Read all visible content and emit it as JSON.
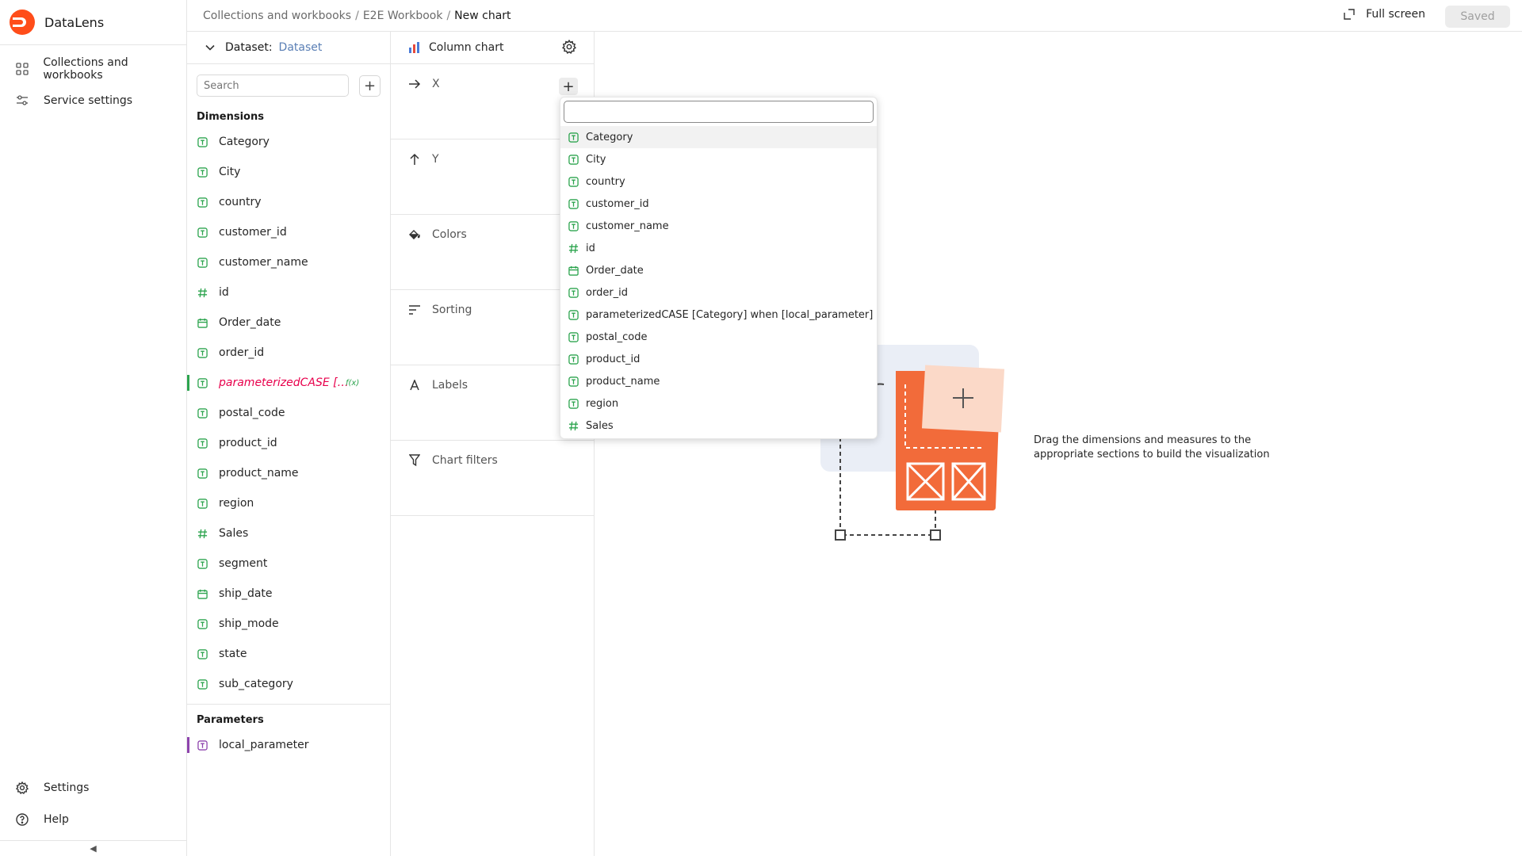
{
  "app": {
    "name": "DataLens"
  },
  "nav": {
    "items": [
      {
        "label": "Collections and workbooks",
        "icon": "grid-icon"
      },
      {
        "label": "Service settings",
        "icon": "sliders-icon"
      }
    ],
    "bottom": [
      {
        "label": "Settings",
        "icon": "gear-icon"
      },
      {
        "label": "Help",
        "icon": "help-icon"
      }
    ],
    "collapse": "◀"
  },
  "breadcrumbs": [
    {
      "label": "Collections and workbooks"
    },
    {
      "label": "E2E Workbook"
    },
    {
      "label": "New chart"
    }
  ],
  "header": {
    "fullscreen_label": "Full screen",
    "saved_label": "Saved"
  },
  "dataset": {
    "label": "Dataset:",
    "name": "Dataset",
    "search_placeholder": "Search",
    "dimensions_title": "Dimensions",
    "fields": [
      {
        "name": "Category",
        "type": "text"
      },
      {
        "name": "City",
        "type": "text"
      },
      {
        "name": "country",
        "type": "text"
      },
      {
        "name": "customer_id",
        "type": "text"
      },
      {
        "name": "customer_name",
        "type": "text"
      },
      {
        "name": "id",
        "type": "number"
      },
      {
        "name": "Order_date",
        "type": "date"
      },
      {
        "name": "order_id",
        "type": "text"
      },
      {
        "name": "parameterizedCASE […",
        "type": "text",
        "active": true,
        "fx": "f(x)"
      },
      {
        "name": "postal_code",
        "type": "text"
      },
      {
        "name": "product_id",
        "type": "text"
      },
      {
        "name": "product_name",
        "type": "text"
      },
      {
        "name": "region",
        "type": "text"
      },
      {
        "name": "Sales",
        "type": "number"
      },
      {
        "name": "segment",
        "type": "text"
      },
      {
        "name": "ship_date",
        "type": "date"
      },
      {
        "name": "ship_mode",
        "type": "text"
      },
      {
        "name": "state",
        "type": "text"
      },
      {
        "name": "sub_category",
        "type": "text"
      }
    ],
    "parameters_title": "Parameters",
    "parameters": [
      {
        "name": "local_parameter",
        "type": "text"
      }
    ]
  },
  "placeholders": {
    "chart_type": "Column chart",
    "sections": [
      {
        "label": "X",
        "icon": "arrow-right-icon"
      },
      {
        "label": "Y",
        "icon": "arrow-up-icon"
      },
      {
        "label": "Colors",
        "icon": "paint-bucket-icon"
      },
      {
        "label": "Sorting",
        "icon": "sort-icon"
      },
      {
        "label": "Labels",
        "icon": "label-a-icon"
      },
      {
        "label": "Chart filters",
        "icon": "filter-icon"
      }
    ]
  },
  "popup": {
    "options": [
      {
        "name": "Category",
        "type": "text"
      },
      {
        "name": "City",
        "type": "text"
      },
      {
        "name": "country",
        "type": "text"
      },
      {
        "name": "customer_id",
        "type": "text"
      },
      {
        "name": "customer_name",
        "type": "text"
      },
      {
        "name": "id",
        "type": "number"
      },
      {
        "name": "Order_date",
        "type": "date"
      },
      {
        "name": "order_id",
        "type": "text"
      },
      {
        "name": "parameterizedCASE [Category] when [local_parameter] …",
        "type": "text"
      },
      {
        "name": "postal_code",
        "type": "text"
      },
      {
        "name": "product_id",
        "type": "text"
      },
      {
        "name": "product_name",
        "type": "text"
      },
      {
        "name": "region",
        "type": "text"
      },
      {
        "name": "Sales",
        "type": "number"
      }
    ]
  },
  "empty_state": {
    "line1": "Drag the dimensions and measures to the",
    "line2": "appropriate sections to build the visualization"
  },
  "colors": {
    "accent_green": "#2ca44e",
    "active_field": "#e8004c",
    "param_marker": "#8e44ad",
    "brand_orange": "#ff6b2c"
  }
}
